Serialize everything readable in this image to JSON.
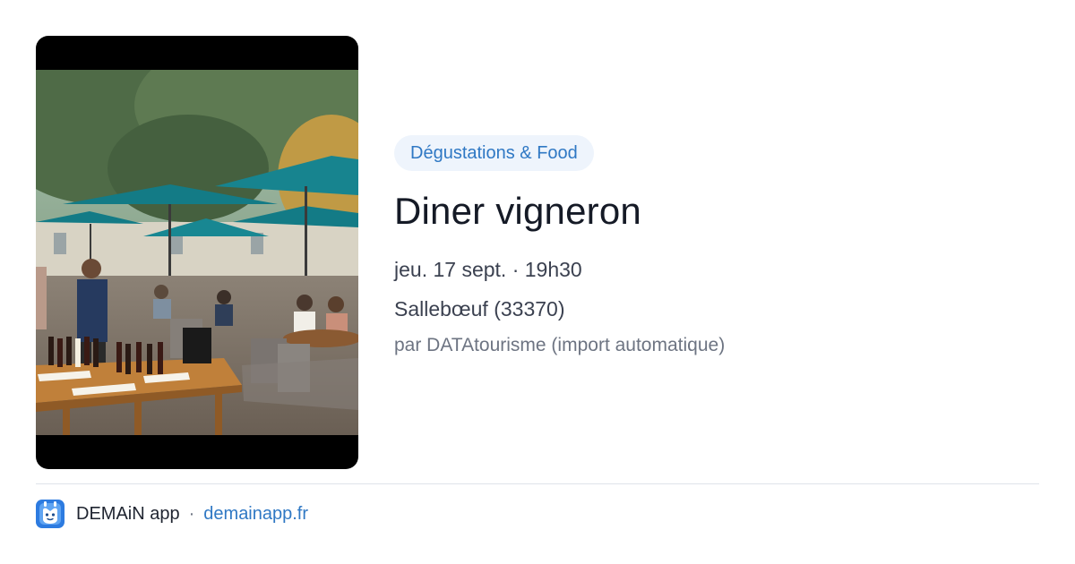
{
  "event": {
    "category": "Dégustations & Food",
    "title": "Diner vigneron",
    "date": "jeu. 17 sept. · 19h30",
    "location": "Sallebœuf (33370)",
    "source": "par DATAtourisme (import automatique)"
  },
  "footer": {
    "app_name": "DEMAiN app",
    "separator": "·",
    "link": "demainapp.fr",
    "logo_icon": "demain-app-logo-icon"
  },
  "colors": {
    "accent": "#2f78c4",
    "chip_background": "#eef4fc",
    "logo_blue": "#2d7be0"
  }
}
